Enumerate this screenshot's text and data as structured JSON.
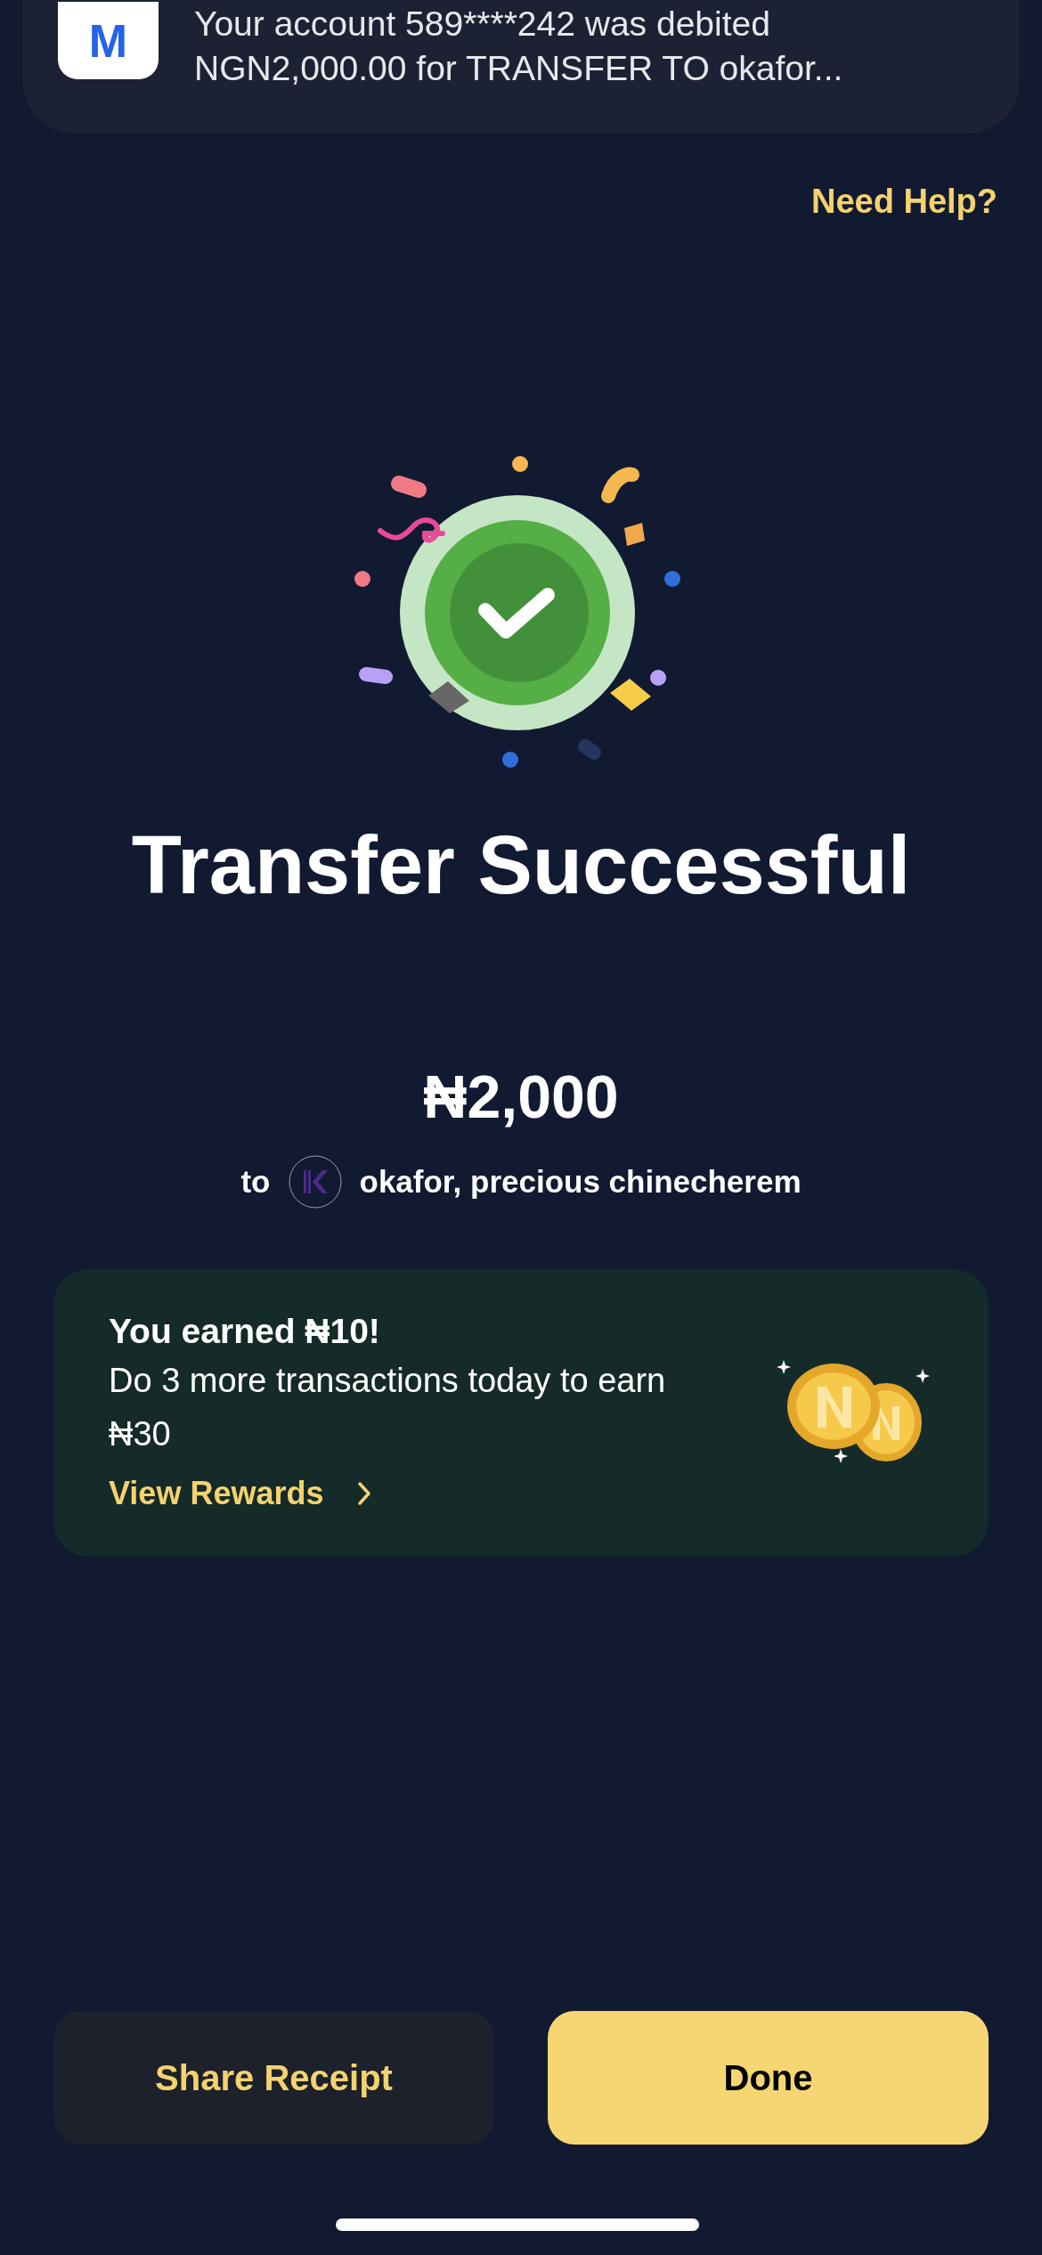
{
  "notification": {
    "app_icon_letter": "M",
    "message": "Your account 589****242 was debited NGN2,000.00 for TRANSFER TO okafor..."
  },
  "help_link": "Need Help?",
  "title": "Transfer Successful",
  "amount": "₦2,000",
  "recipient": {
    "prefix": "to",
    "name": "okafor, precious chinecherem"
  },
  "reward": {
    "title": "You earned ₦10!",
    "body": "Do 3 more transactions today to earn ₦30",
    "link": "View Rewards"
  },
  "buttons": [
    {
      "label": "Share Receipt",
      "kind": "secondary"
    },
    {
      "label": "Done",
      "kind": "primary"
    }
  ]
}
